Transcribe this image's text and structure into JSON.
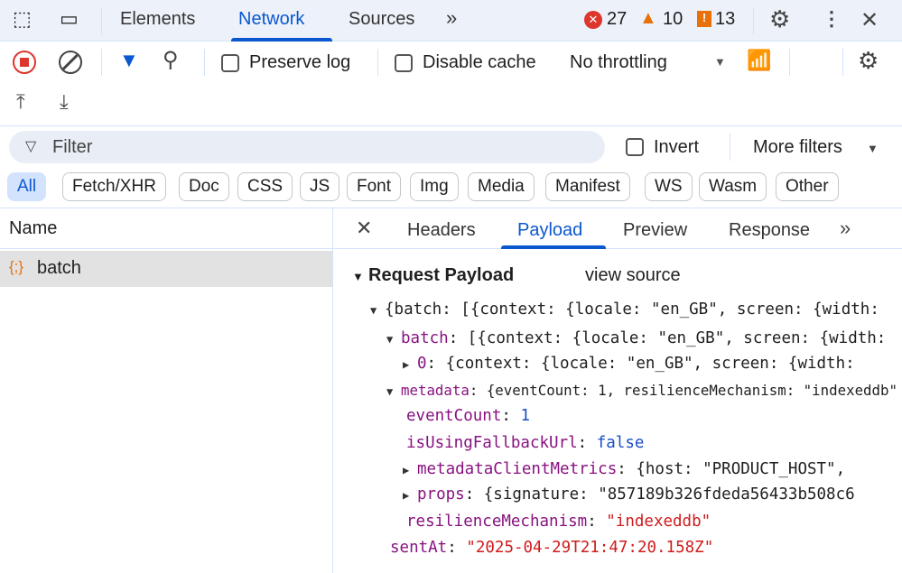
{
  "topbar": {
    "tabs": [
      "Elements",
      "Network",
      "Sources"
    ],
    "active_tab": "Network",
    "more": "»",
    "errors": "27",
    "warnings": "10",
    "issues": "13"
  },
  "toolbar": {
    "preserve_log": "Preserve log",
    "disable_cache": "Disable cache",
    "throttling": "No throttling"
  },
  "filter": {
    "placeholder": "Filter",
    "invert": "Invert",
    "more_filters": "More filters"
  },
  "chips": [
    "All",
    "Fetch/XHR",
    "Doc",
    "CSS",
    "JS",
    "Font",
    "Img",
    "Media",
    "Manifest",
    "WS",
    "Wasm",
    "Other"
  ],
  "list": {
    "header": "Name",
    "rows": [
      {
        "name": "batch"
      }
    ]
  },
  "detail": {
    "tabs": [
      "Headers",
      "Payload",
      "Preview",
      "Response"
    ],
    "active_tab": "Payload",
    "section": "Request Payload",
    "view_source": "view source"
  },
  "tree": [
    {
      "key": "",
      "value": "{batch: [{context: {locale: \"en_GB\", screen: {width:"
    },
    {
      "key": "batch",
      "value": "[{context: {locale: \"en_GB\", screen: {width:"
    },
    {
      "key": "0",
      "value": "{context: {locale: \"en_GB\", screen: {width:"
    },
    {
      "key": "metadata",
      "value": "{eventCount: 1, resilienceMechanism: \"indexeddb\""
    },
    {
      "key": "eventCount",
      "value": "1"
    },
    {
      "key": "isUsingFallbackUrl",
      "value": "false"
    },
    {
      "key": "metadataClientMetrics",
      "value": "{host: \"PRODUCT_HOST\", "
    },
    {
      "key": "props",
      "value": "{signature: \"857189b326fdeda56433b508c6"
    },
    {
      "key": "resilienceMechanism",
      "value": "\"indexeddb\""
    },
    {
      "key": "sentAt",
      "value": "\"2025-04-29T21:47:20.158Z\""
    }
  ]
}
